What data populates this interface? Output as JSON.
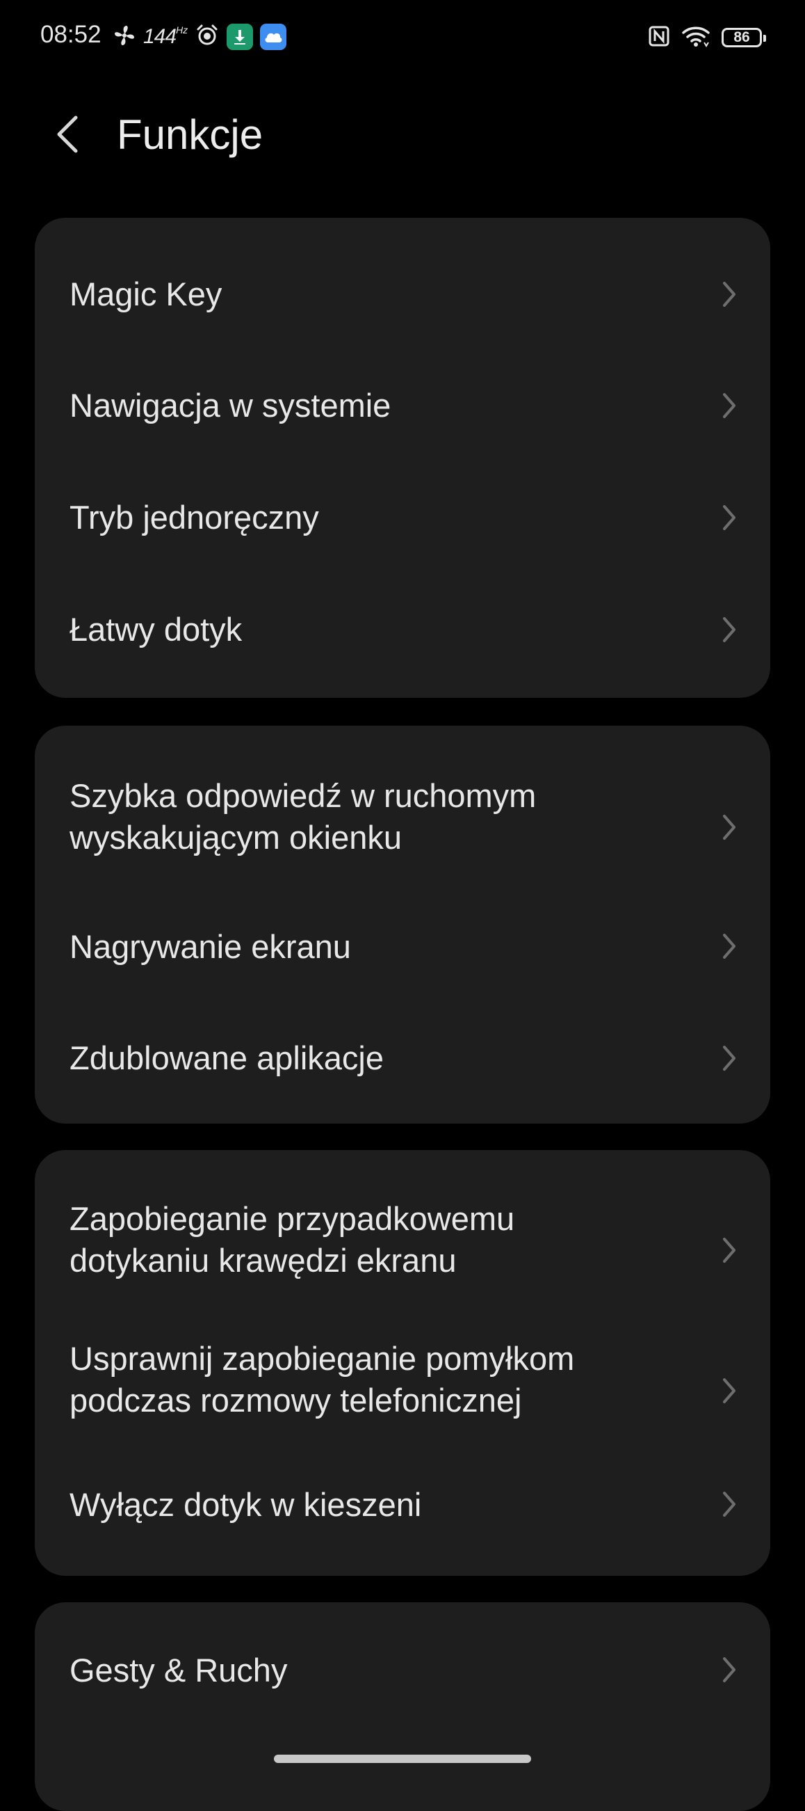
{
  "status_bar": {
    "time": "08:52",
    "refresh_rate": "144",
    "refresh_unit": "Hz",
    "battery": "86",
    "icons_left": [
      "fan-icon",
      "refresh-rate-icon",
      "alarm-icon",
      "green-app-icon",
      "cloud-app-icon"
    ],
    "icons_right": [
      "nfc-icon",
      "wifi-icon",
      "battery-icon"
    ]
  },
  "header": {
    "title": "Funkcje"
  },
  "groups": [
    {
      "items": [
        {
          "label": "Magic Key"
        },
        {
          "label": "Nawigacja w systemie"
        },
        {
          "label": "Tryb jednoręczny"
        },
        {
          "label": "Łatwy dotyk"
        }
      ]
    },
    {
      "items": [
        {
          "label": "Szybka odpowiedź w ruchomym wyskakującym okienku"
        },
        {
          "label": "Nagrywanie ekranu"
        },
        {
          "label": "Zdublowane aplikacje"
        }
      ]
    },
    {
      "items": [
        {
          "label": "Zapobieganie przypadkowemu dotykaniu krawędzi ekranu"
        },
        {
          "label": "Usprawnij zapobieganie pomyłkom podczas rozmowy telefonicznej"
        },
        {
          "label": "Wyłącz dotyk w kieszeni"
        }
      ]
    },
    {
      "items": [
        {
          "label": "Gesty & Ruchy"
        }
      ]
    }
  ],
  "colors": {
    "background": "#000000",
    "card": "#1e1e1e",
    "text": "#e8e8e8",
    "chevron": "#6e6e6e",
    "green_app": "#1d9a6c",
    "cloud_app": "#3d8ef0"
  }
}
